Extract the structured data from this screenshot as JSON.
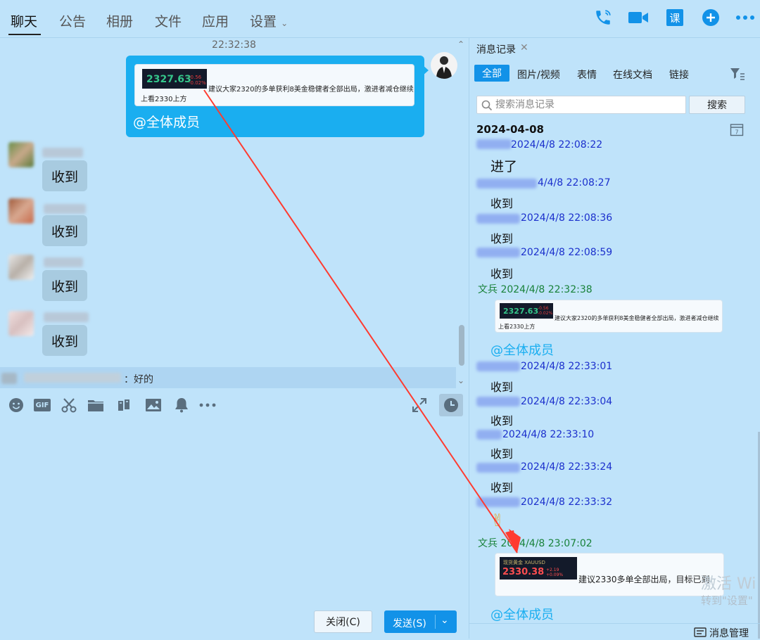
{
  "tabs": [
    {
      "label": "聊天"
    },
    {
      "label": "公告"
    },
    {
      "label": "相册"
    },
    {
      "label": "文件"
    },
    {
      "label": "应用"
    },
    {
      "label": "设置"
    }
  ],
  "top_icons": [
    "phone-icon",
    "video-call-icon",
    "course-icon",
    "add-icon",
    "more-icon"
  ],
  "course_label": "课",
  "chat": {
    "timestamp": "22:32:38",
    "out_message": {
      "quote_price": "2327.63",
      "quote_delta_1": "-0.56",
      "quote_delta_2": "-0.02%",
      "quote_text_1": "建议大家2320的多单获利8美金稳健者全部出局，激进者减仓继续",
      "quote_text_2": "上看2330上方",
      "mention": "@全体成员"
    },
    "incoming": [
      {
        "text": "收到"
      },
      {
        "text": "收到"
      },
      {
        "text": "收到"
      },
      {
        "text": "收到"
      }
    ],
    "reply_preview": "：好的"
  },
  "toolbar": [
    "emoji-icon",
    "gif-icon",
    "scissors-icon",
    "folder-icon",
    "shake-icon",
    "image-icon",
    "bell-icon",
    "more-icon"
  ],
  "gif_label": "GIF",
  "buttons": {
    "close": "关闭(C)",
    "send": "发送(S)"
  },
  "history": {
    "title": "消息记录",
    "filters": [
      "全部",
      "图片/视频",
      "表情",
      "在线文档",
      "链接"
    ],
    "search_placeholder": "搜索消息记录",
    "search_button": "搜索",
    "date": "2024-04-08",
    "calendar_day": "7",
    "entries": [
      {
        "meta": "2024/4/8 22:08:22",
        "msg": "进了"
      },
      {
        "meta": "4/4/8 22:08:27",
        "msg": "收到"
      },
      {
        "meta": "2024/4/8 22:08:36",
        "msg": "收到"
      },
      {
        "meta": "2024/4/8 22:08:59",
        "msg": "收到"
      },
      {
        "meta": "文兵 2024/4/8 22:32:38",
        "msg": ""
      },
      {
        "meta": "2024/4/8 22:33:01",
        "msg": "收到"
      },
      {
        "meta": "2024/4/8 22:33:04",
        "msg": "收到"
      },
      {
        "meta": "2024/4/8 22:33:10",
        "msg": "收到"
      },
      {
        "meta": "2024/4/8 22:33:24",
        "msg": "收到"
      },
      {
        "meta": "2024/4/8 22:33:32",
        "msg": "✌"
      },
      {
        "meta": "文兵 2024/4/8 23:07:02",
        "msg": ""
      }
    ],
    "card1": {
      "price": "2327.63",
      "delta_1": "-0.56",
      "delta_2": "-0.02%",
      "text_1": "建议大家2320的多单获利8美金稳健者全部出局，激进者减仓继续",
      "text_2": "上看2330上方"
    },
    "mention_1": "@全体成员",
    "card2": {
      "header": "现货黄金  XAUUSD",
      "price": "2330.38",
      "delta_1": "+2.19",
      "delta_2": "+0.09%",
      "text": "建议2330多单全部出局，目标已到"
    },
    "mention_2": "@全体成员",
    "manage": "消息管理"
  },
  "watermark": {
    "line1": "激活 Wi",
    "line2": "转到\"设置\""
  },
  "colors": {
    "accent": "#1292e8",
    "bubble": "#1aaef0",
    "bg": "#bfe3fa",
    "annotation_arrow": "#ff3b30"
  }
}
